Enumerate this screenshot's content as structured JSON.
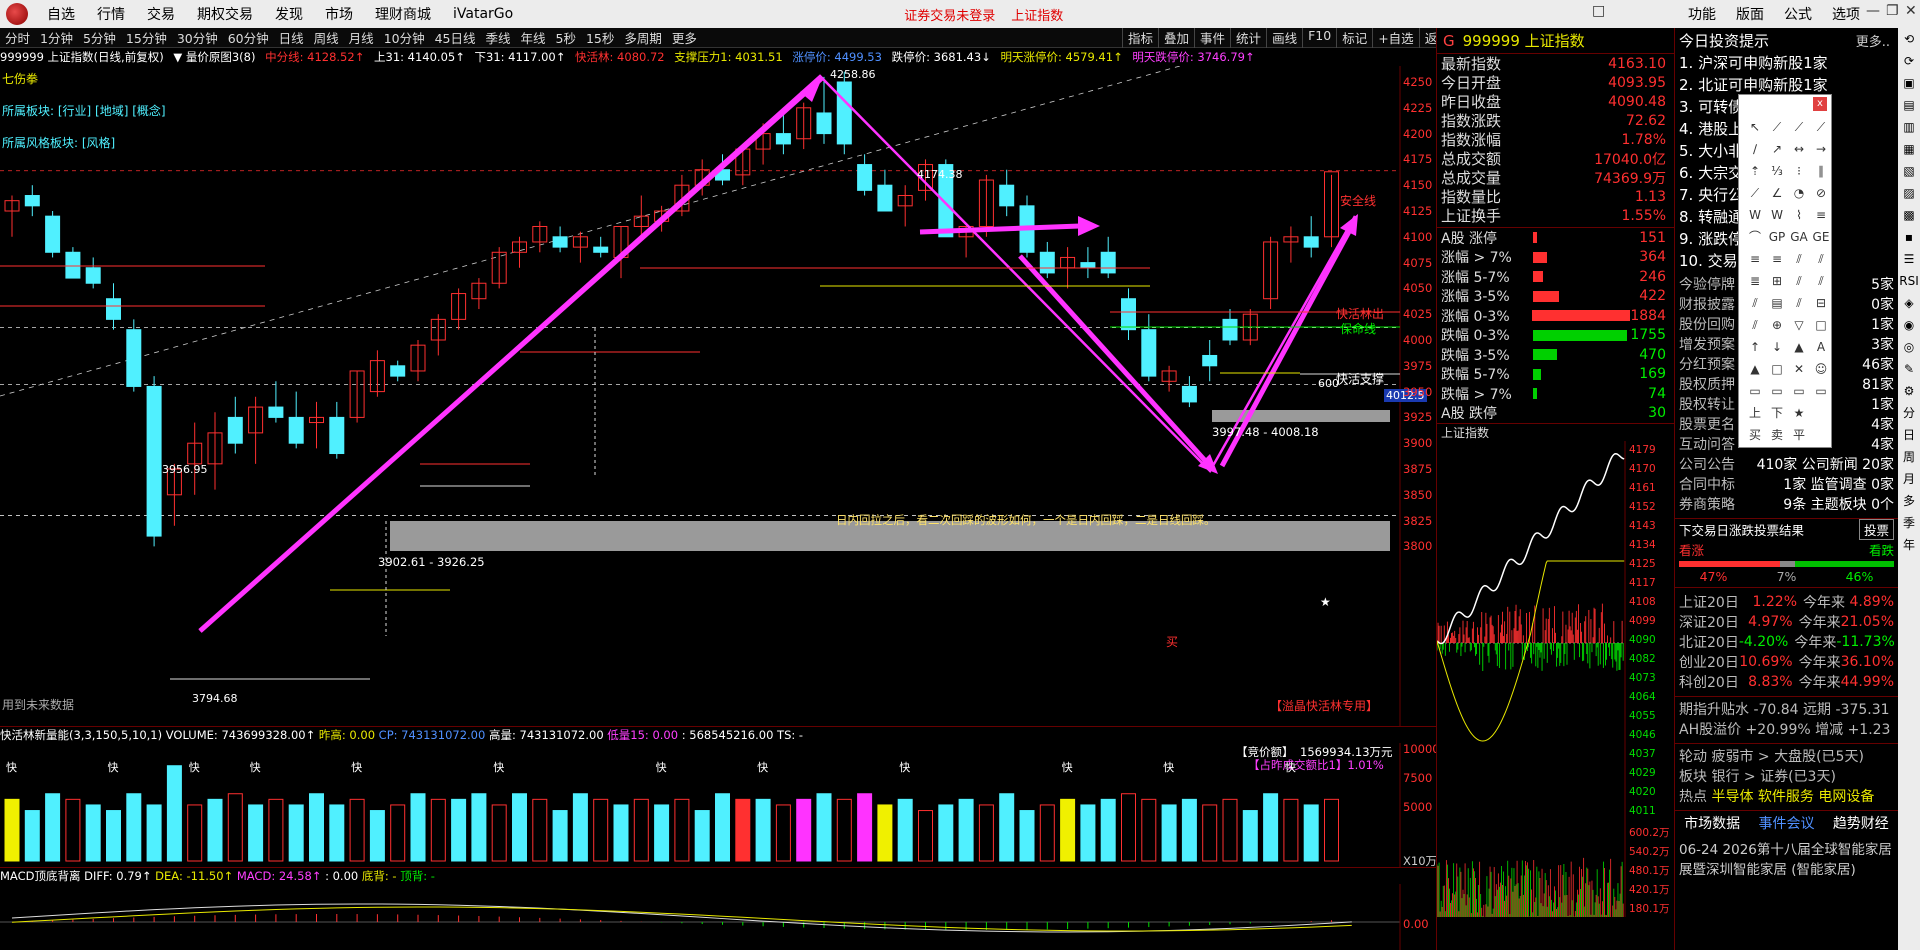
{
  "menu": {
    "items": [
      "自选",
      "行情",
      "交易",
      "期权交易",
      "发现",
      "市场",
      "理财商城",
      "iVatarGo"
    ],
    "alert_login": "证券交易未登录",
    "alert_index": "上证指数",
    "right_items": [
      "功能",
      "版面",
      "公式",
      "选项"
    ],
    "window_controls": [
      "□",
      "—",
      "❐",
      "✕"
    ]
  },
  "periods": [
    "分时",
    "1分钟",
    "5分钟",
    "15分钟",
    "30分钟",
    "60分钟",
    "日线",
    "周线",
    "月线",
    "10分钟",
    "45日线",
    "季线",
    "年线",
    "5秒",
    "15秒",
    "多周期",
    "更多"
  ],
  "toolright": [
    "指标",
    "叠加",
    "事件",
    "统计",
    "画线",
    "F10",
    "标记",
    "+自选",
    "返回"
  ],
  "chartinfo": {
    "name": "999999 上证指数(日线,前复权)",
    "mode": "▼ 量价原图3(8)",
    "mid": "中分线: 4128.52↑",
    "up31": "上31: 4140.05↑",
    "down31": "下31: 4117.00↑",
    "quick": "快活林: 4080.72",
    "support": "支撑压力1: 4031.51",
    "limitup_price": "涨停价: 4499.53",
    "limitdown": "跌停价: 3681.43↓",
    "next_up": "明天涨停价: 4579.41↑",
    "next_down": "明天跌停价: 3746.79↑"
  },
  "side_labels": {
    "l1": "七伤拳",
    "l2": "所属板块: [行业] [地域] [概念]",
    "l3": "所属风格板块: [风格]",
    "future": "用到未来数据",
    "special": "【溢晶快活林专用】"
  },
  "annotations": {
    "high": "4258.86",
    "mid_high": "4174.38",
    "low": "3794.68",
    "box1": "3956.95",
    "range1": "3902.61 - 3926.25",
    "range2": "3997.48 - 4008.18",
    "safe": "安全线",
    "quick_sell": "快活林出",
    "life": "保命线",
    "quick_support": "快活支撑",
    "num600": "600",
    "buy": "买",
    "note": "日内回拉之后，看二次回踩的波形如何，一个是日内回踩，二是日线回踩。",
    "price_tag": "4012.5"
  },
  "price_axis": [
    "4250",
    "4225",
    "4200",
    "4175",
    "4150",
    "4125",
    "4100",
    "4075",
    "4050",
    "4025",
    "4000",
    "3975",
    "3950",
    "3925",
    "3900",
    "3875",
    "3850",
    "3825",
    "3800"
  ],
  "volume": {
    "title": "快活林新量能(3,3,150,5,10,1) VOLUME: 743699328.00↑",
    "prev_high": "昨高: 0.00",
    "cp": "CP: 743131072.00",
    "high": "高量: 743131072.00",
    "low15": "低量15: 0.00",
    "extra": ": 568545216.00  TS: -",
    "bid": "【竞价额】",
    "bid_val": "1569934.13万元",
    "ratio": "【占昨成交额比1】1.01%",
    "axis": [
      "10000",
      "7500",
      "5000",
      "X10万"
    ],
    "marker": "快"
  },
  "macd": {
    "title": "MACD顶底背离",
    "diff": "DIFF: 0.79↑",
    "dea": "DEA: -11.50↑",
    "macd": "MACD: 24.58↑",
    "zero": ": 0.00",
    "bottom": "底背: -",
    "top": "顶背: -",
    "axis": "0.00"
  },
  "quote": {
    "code": "999999",
    "name": "上证指数",
    "g": "G",
    "rows": [
      {
        "k": "最新指数",
        "v": "4163.10"
      },
      {
        "k": "今日开盘",
        "v": "4093.95"
      },
      {
        "k": "昨日收盘",
        "v": "4090.48"
      },
      {
        "k": "指数涨跌",
        "v": "72.62"
      },
      {
        "k": "指数涨幅",
        "v": "1.78%"
      },
      {
        "k": "总成交额",
        "v": "17040.0亿"
      },
      {
        "k": "总成交量",
        "v": "74369.9万"
      },
      {
        "k": "指数量比",
        "v": "1.13"
      },
      {
        "k": "上证换手",
        "v": "1.55%"
      }
    ],
    "breadth": [
      {
        "k": "A股 涨停",
        "v": "151",
        "c": "red",
        "w": 4
      },
      {
        "k": "涨幅 > 7%",
        "v": "364",
        "c": "red",
        "w": 14
      },
      {
        "k": "涨幅 5-7%",
        "v": "246",
        "c": "red",
        "w": 10
      },
      {
        "k": "涨幅 3-5%",
        "v": "422",
        "c": "red",
        "w": 26
      },
      {
        "k": "涨幅 0-3%",
        "v": "1884",
        "c": "red",
        "w": 100
      },
      {
        "k": "跌幅 0-3%",
        "v": "1755",
        "c": "grn",
        "w": 94
      },
      {
        "k": "跌幅 3-5%",
        "v": "470",
        "c": "grn",
        "w": 24
      },
      {
        "k": "跌幅 5-7%",
        "v": "169",
        "c": "grn",
        "w": 8
      },
      {
        "k": "跌幅 > 7%",
        "v": "74",
        "c": "grn",
        "w": 4
      },
      {
        "k": "A股 跌停",
        "v": "30",
        "c": "grn",
        "w": 0
      }
    ],
    "intraday_title": "上证指数",
    "intraday_axis": [
      "4179",
      "4170",
      "4161",
      "4152",
      "4143",
      "4134",
      "4125",
      "4117",
      "4108",
      "4099",
      "4090",
      "4082",
      "4073",
      "4064",
      "4055",
      "4046",
      "4037",
      "4029",
      "4020",
      "4011"
    ],
    "intraday_vol": [
      "600.2万",
      "540.2万",
      "480.1万",
      "420.1万",
      "180.1万"
    ]
  },
  "tips": {
    "title": "今日投资提示",
    "more": "更多..",
    "items": [
      "1. 沪深可申购新股1家",
      "2. 北证可申购新股1家",
      "3. 可转债",
      "4. 港股上",
      "5. 大小非",
      "6. 大宗交",
      "7. 央行公",
      "8. 转融通",
      "9. 涨跌停",
      "10. 交易方"
    ],
    "stats": [
      {
        "a": "今验停牌",
        "b": "5家"
      },
      {
        "a": "财报披露",
        "b": "0家"
      },
      {
        "a": "股份回购",
        "b": "1家"
      },
      {
        "a": "增发预案",
        "b": "3家"
      },
      {
        "a": "分红预案",
        "b": "46家"
      },
      {
        "a": "股权质押",
        "b": "81家"
      },
      {
        "a": "股权转让",
        "b": "1家"
      },
      {
        "a": "股票更名",
        "b": "4家"
      },
      {
        "a": "互动问答",
        "b": "4家"
      },
      {
        "a": "公司公告",
        "b": "410家 公司新闻 20家"
      },
      {
        "a": "合同中标",
        "b": "1家 监管调查 0家"
      },
      {
        "a": "券商策略",
        "b": "9条 主题板块 0个"
      }
    ],
    "vote_title": "下交易日涨跌投票结果",
    "vote_btn": "投票",
    "vote_up": "看涨",
    "vote_down": "看跌",
    "vote_pcts": [
      "47%",
      "7%",
      "46%"
    ],
    "perf": [
      {
        "k": "上证20日",
        "a": "1.22%",
        "b": "今年来",
        "c": "4.89%"
      },
      {
        "k": "深证20日",
        "a": "4.97%",
        "b": "今年来",
        "c": "21.05%"
      },
      {
        "k": "北证20日",
        "a": "-4.20%",
        "b": "今年来",
        "c": "-11.73%"
      },
      {
        "k": "创业20日",
        "a": "10.69%",
        "b": "今年来",
        "c": "36.10%"
      },
      {
        "k": "科创20日",
        "a": "8.83%",
        "b": "今年来",
        "c": "44.99%"
      }
    ],
    "futures": "期指升贴水 -70.84 远期 -375.31",
    "ah": "AH股溢价 +20.99% 增减 +1.23",
    "rotation": "轮动 疲弱市 > 大盘股(已5天)",
    "sector": "板块 银行 > 证券(已3天)",
    "hot_label": "热点",
    "hot": "半导体 软件服务 电网设备",
    "tabs": [
      "市场数据",
      "事件会议",
      "趋势财经"
    ],
    "event": "06-24 2026第十八届全球智能家居展暨深圳智能家居 (智能家居)"
  },
  "vtools": [
    "分",
    "日",
    "周",
    "月",
    "多",
    "季",
    "年"
  ],
  "draw_tools": [
    "↖",
    "⟋",
    "⟋",
    "⟋",
    "∕",
    "↗",
    "↔",
    "→",
    "⇡",
    "⅓",
    "⁝",
    "∥",
    "⟋",
    "∠",
    "◔",
    "⊘",
    "W",
    "W",
    "⌇",
    "≡",
    "⌒",
    "GP",
    "GA",
    "GE",
    "≡",
    "≡",
    "⫽",
    "⫽",
    "≣",
    "⊞",
    "⫽",
    "⫽",
    "⫽",
    "▤",
    "⫽",
    "⊟",
    "⫽",
    "⊕",
    "▽",
    "□",
    "↑",
    "↓",
    "▲",
    "A",
    "▲",
    "□",
    "✕",
    "☺",
    "▭",
    "▭",
    "▭",
    "▭",
    "上",
    "下",
    "★",
    "",
    "买",
    "卖",
    "平",
    ""
  ]
}
